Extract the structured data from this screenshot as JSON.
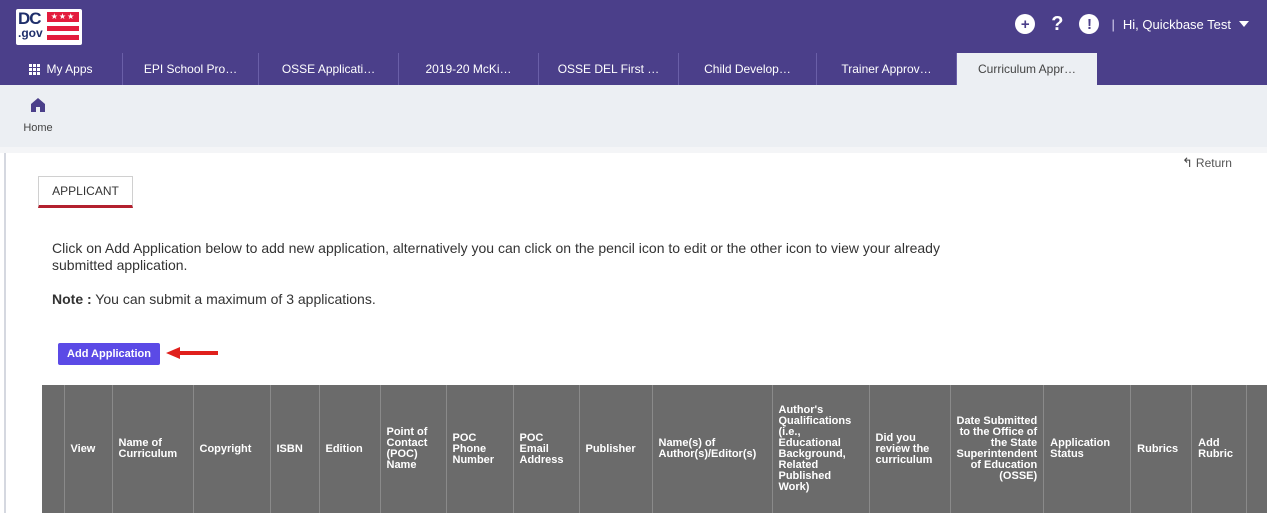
{
  "brand": {
    "logo_text_top": "DC",
    "logo_text_bottom": ".gov",
    "logo_stars": "★★★"
  },
  "header": {
    "add_icon": "plus-circle-icon",
    "help_icon": "question-mark-icon",
    "alert_icon": "exclamation-circle-icon",
    "separator": "|",
    "user_greeting": "Hi, Quickbase Test",
    "colors": {
      "bar": "#4b3f8a"
    }
  },
  "app_tabs": [
    {
      "label": "My Apps",
      "icon": "grid-icon"
    },
    {
      "label": "EPI School Pro…"
    },
    {
      "label": "OSSE Applicati…"
    },
    {
      "label": "2019-20 McKi…"
    },
    {
      "label": "OSSE DEL First …"
    },
    {
      "label": "Child Develop…"
    },
    {
      "label": "Trainer Approv…"
    },
    {
      "label": "Curriculum Appr…",
      "active": true
    }
  ],
  "home": {
    "label": "Home",
    "icon": "home-icon"
  },
  "return_link": {
    "label": "Return",
    "icon": "return-arrow-icon"
  },
  "section_tab": {
    "label": "APPLICANT",
    "underline_color": "#b3202e"
  },
  "instructions": "Click on Add Application below to add new application, alternatively you can click on the pencil icon to edit or the other icon to view your already submitted application.",
  "note": {
    "label": "Note :",
    "text": " You can submit a maximum of 3 applications."
  },
  "add_button": {
    "label": "Add Application",
    "color": "#5b4ae6"
  },
  "arrow_color": "#e0201c",
  "table": {
    "header_bg": "#6b6b6b",
    "columns": [
      "",
      "View",
      "Name of Curriculum",
      "Copyright",
      "ISBN",
      "Edition",
      "Point of Contact (POC) Name",
      "POC Phone Number",
      "POC Email Address",
      "Publisher",
      "Name(s) of Author(s)/Editor(s)",
      "Author's Qualifications (i.e., Educational Background, Related Published Work)",
      "Did you review the curriculum",
      "Date Submitted to the Office of the State Superintendent of Education (OSSE)",
      "Application Status",
      "Rubrics",
      "Add Rubric"
    ]
  }
}
